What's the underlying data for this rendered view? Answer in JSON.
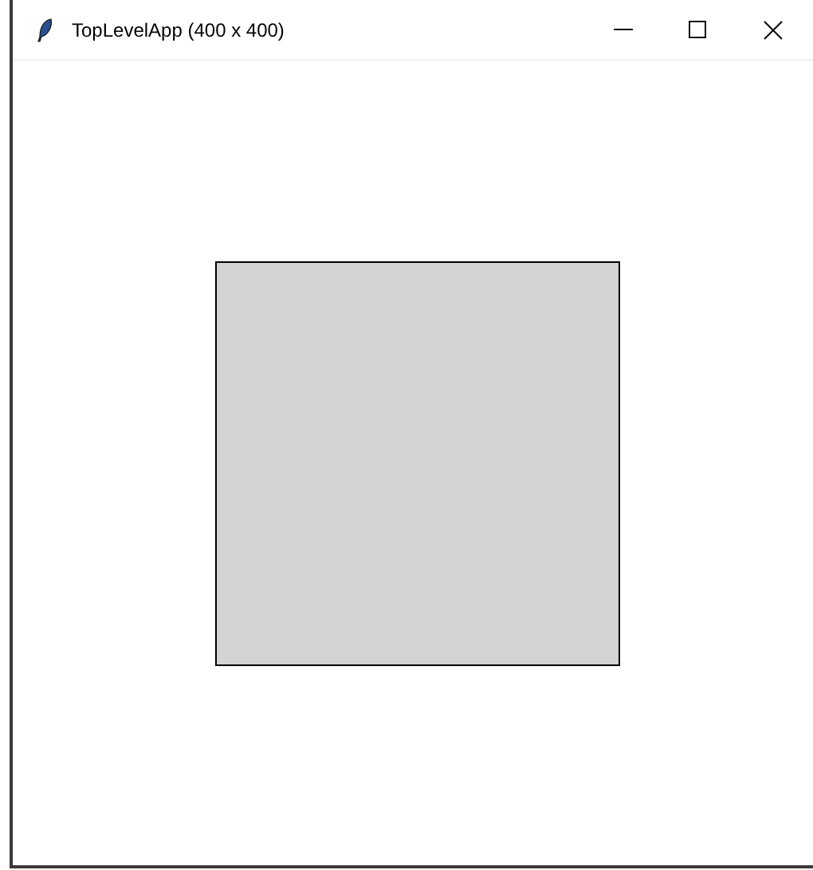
{
  "window": {
    "title": "TopLevelApp (400 x 400)"
  },
  "canvas": {
    "shapes": [
      {
        "kind": "rectangle"
      }
    ]
  }
}
